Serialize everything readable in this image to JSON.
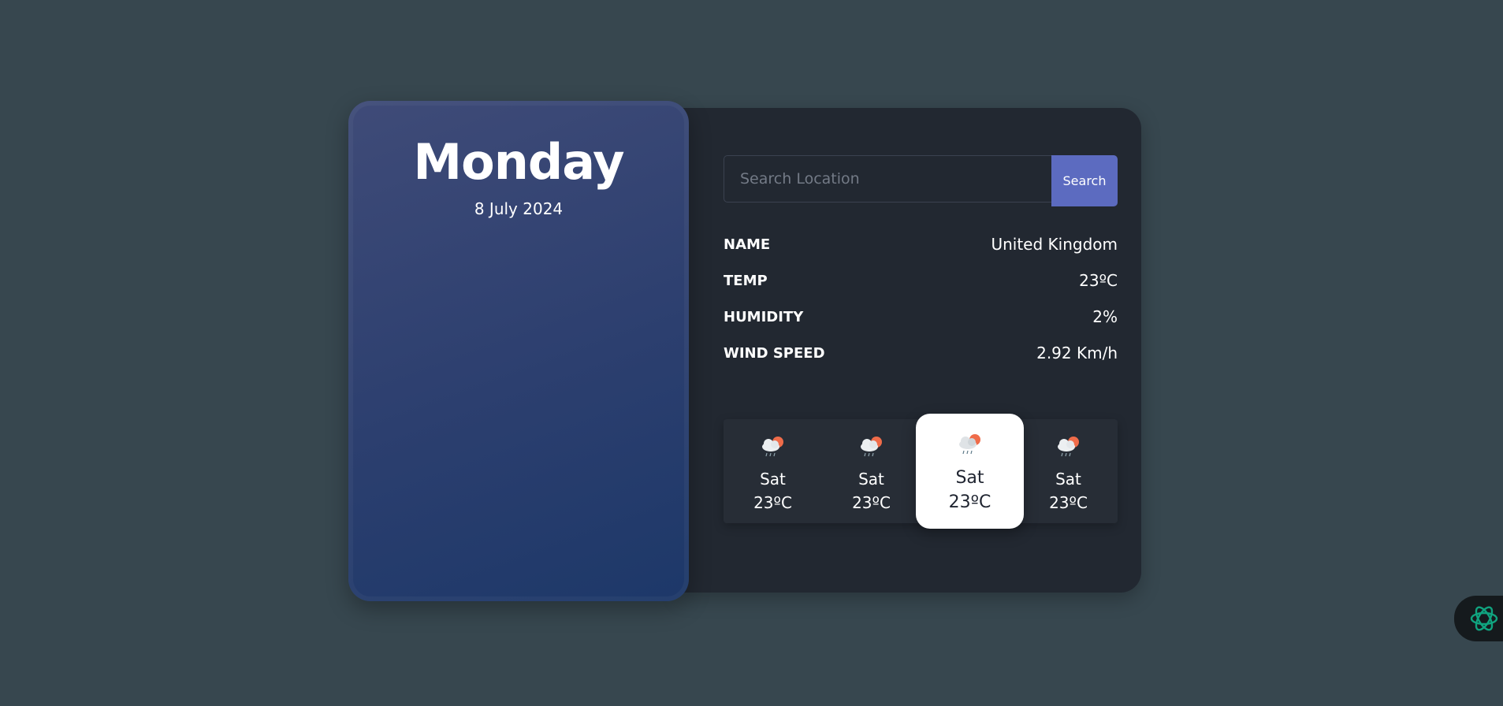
{
  "left_card": {
    "day": "Monday",
    "date": "8 July 2024"
  },
  "search": {
    "placeholder": "Search Location",
    "button_label": "Search"
  },
  "info": [
    {
      "label": "NAME",
      "value": "United Kingdom"
    },
    {
      "label": "TEMP",
      "value": "23ºC"
    },
    {
      "label": "HUMIDITY",
      "value": "2%"
    },
    {
      "label": "WIND SPEED",
      "value": "2.92 Km/h"
    }
  ],
  "forecast": [
    {
      "day": "Sat",
      "temp": "23ºC",
      "icon": "rain-cloud-sun-icon"
    },
    {
      "day": "Sat",
      "temp": "23ºC",
      "icon": "rain-cloud-sun-icon"
    },
    {
      "day": "Sat",
      "temp": "23ºC",
      "icon": "rain-cloud-sun-icon",
      "active": true
    },
    {
      "day": "Sat",
      "temp": "23ºC",
      "icon": "rain-cloud-sun-icon"
    }
  ],
  "colors": {
    "background": "#37474f",
    "panel": "#222831",
    "accent": "#5c6bc0",
    "bot_icon": "#10a37f"
  },
  "floating_button": {
    "icon": "openai-logo-icon"
  }
}
